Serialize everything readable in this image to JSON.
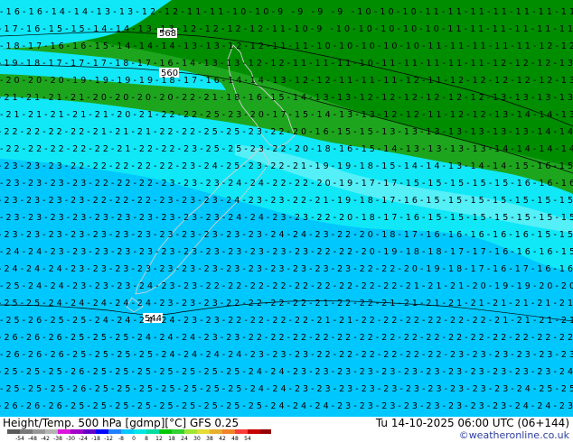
{
  "footer": {
    "title": "Height/Temp. 500 hPa [gdmp][°C] GFS 0.25",
    "valid": "Tu 14-10-2025 06:00 UTC (06+144)",
    "copyright": "©weatheronline.co.uk"
  },
  "legend": {
    "ticks": [
      "-54",
      "-48",
      "-42",
      "-38",
      "-30",
      "-24",
      "-18",
      "-12",
      "-8",
      "0",
      "8",
      "12",
      "18",
      "24",
      "30",
      "38",
      "42",
      "48",
      "54"
    ],
    "colors": [
      "#5a5a5a",
      "#787878",
      "#969696",
      "#b4b4b4",
      "#dc14dc",
      "#a000c8",
      "#6400c8",
      "#0000ff",
      "#2080ff",
      "#00c8ff",
      "#00e6e6",
      "#00dca0",
      "#00c800",
      "#32d232",
      "#a0e632",
      "#e6dc32",
      "#e6af2d",
      "#f08228",
      "#fa3c3c",
      "#c80000",
      "#960000"
    ]
  },
  "map": {
    "colors": {
      "dark_green": "#008d00",
      "mid_green": "#1ea51e",
      "cyan": "#10e8f8",
      "light_blue": "#00c8ff",
      "light_cyan": "#8ef4f8",
      "coast": "#c0c0c0"
    },
    "height_labels": [
      "568",
      "560",
      "544"
    ],
    "temp_rows": [
      "-16-16-14-14-13-13-12-12-11-11-10-10-9 -9 -9 -9 -10-10-10-11-11-11-11-11-11-11",
      "-17-16-15-15-14-14-13-13-12-12-12-12-11-10-9 -10-10-10-10-10-11-11-11-11-11-11",
      "-18-17-16-16-15-14-14-14-13-13-12-12-11-11-10-10-10-10-10-11-11-11-11-11-12-12",
      "-19-18-17-17-17-18-17-16-14-13-13-12-12-11-11-11-10-11-11-11-11-11-12-12-12-13",
      "-20-20-20-19-19-19-19-18-17-16-14-14-13-12-12-11-11-11-12-11-12-12-12-12-12-13",
      "-21-21-21-21-20-20-20-20-22-21-18-16-15-14-13-13-12-12-12-12-12-12-13-13-13-13",
      "-21-21-21-21-21-20-21-22-22-25-23-20-17-15-14-13-13-12-12-11-12-12-13-14-14-13",
      "-22-22-22-22-21-21-21-22-22-25-25-23-22-20-16-15-15-13-13-13-13-13-13-13-14-14",
      "-22-22-22-22-22-21-22-22-23-25-25-23-22-20-18-16-15-14-13-13-13-13-14-14-14-14",
      "-23-23-23-22-22-22-22-22-23-24-25-23-22-21-19-19-18-15-14-14-13-14-14-15-16-15",
      "-23-23-23-23-22-22-22-23-23-23-24-24-22-22-20-19-17-17-15-15-15-15-15-16-16-16",
      "-23-23-23-23-22-22-22-23-23-23-24-23-23-22-21-19-18-17-16-15-15-15-15-15-15-15",
      "-23-23-23-23-23-23-23-23-23-23-24-24-23-23-22-20-18-17-16-15-15-15-15-15-15-15",
      "-23-23-23-23-23-23-23-23-23-23-23-23-24-24-23-22-20-18-17-16-16-16-16-16-15-15",
      "-24-24-23-23-23-23-23-23-23-23-23-23-23-23-22-22-20-19-18-18-17-17-16-16-16-15",
      "-24-24-24-23-23-23-23-23-23-23-23-23-23-23-23-23-22-22-20-19-18-17-16-17-16-16",
      "-25-24-24-23-23-23-24-23-23-22-22-22-22-22-22-22-22-22-21-21-21-20-19-19-20-20",
      "-25-25-24-24-24-24-24-23-23-23-22-22-22-22-21-22-22-21-21-21-21-21-21-21-21-21",
      "-25-26-25-25-24-24-24-24-23-23-22-22-22-22-21-21-22-22-22-22-22-22-21-21-21-21",
      "-26-26-26-25-25-25-24-24-24-23-23-22-22-22-22-22-22-22-22-22-22-22-22-22-22-22",
      "-26-26-26-25-25-25-25-24-24-24-24-23-23-23-22-22-22-22-22-22-23-23-23-23-23-23",
      "-25-25-25-26-25-25-25-25-25-25-25-24-24-23-23-23-23-23-23-23-23-23-23-23-23-24",
      "-25-25-25-26-25-25-25-25-25-25-25-24-24-23-23-23-23-23-23-23-23-23-23-24-25-25",
      "-26-26-26-25-25-25-25-25-25-25-25-25-24-24-24-23-23-23-23-23-23-23-23-24-24-23"
    ]
  }
}
